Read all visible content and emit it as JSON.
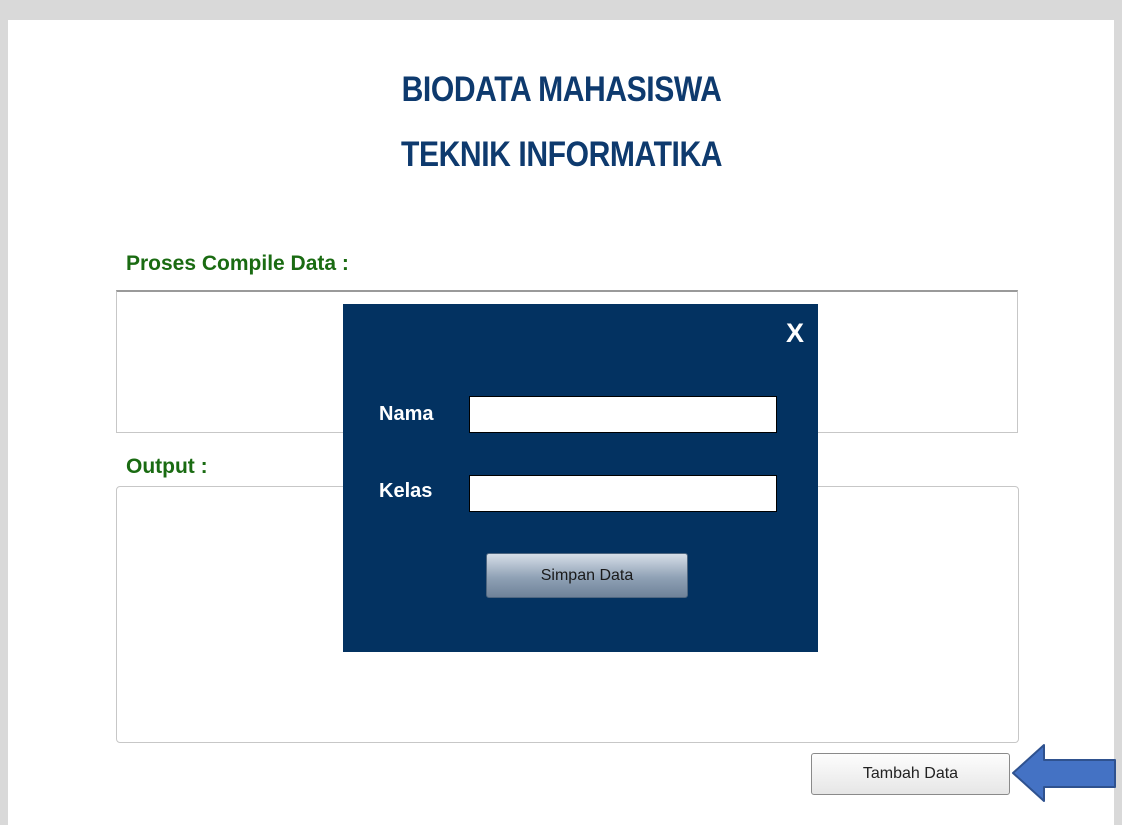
{
  "header": {
    "title_line1": "BIODATA MAHASISWA",
    "title_line2": "TEKNIK INFORMATIKA"
  },
  "sections": {
    "compile_label": "Proses Compile Data :",
    "output_label": "Output :"
  },
  "actions": {
    "add_data_label": "Tambah Data"
  },
  "modal": {
    "close_label": "X",
    "name_label": "Nama",
    "name_value": "",
    "class_label": "Kelas",
    "class_value": "",
    "save_label": "Simpan Data"
  },
  "colors": {
    "title": "#0e3a6e",
    "section_label": "#1a6b12",
    "modal_background": "#033261",
    "arrow": "#4472c4"
  },
  "icons": {
    "pointer_arrow": "arrow-left-icon"
  }
}
